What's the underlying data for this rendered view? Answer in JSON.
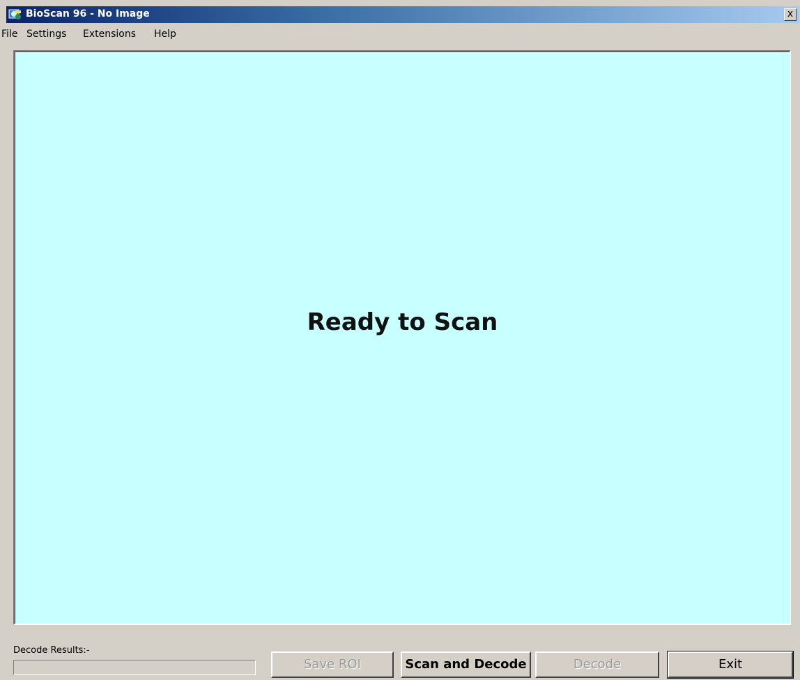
{
  "window": {
    "title": "BioScan 96 - No Image",
    "close_label": "x"
  },
  "menu": {
    "items": [
      "File",
      "Settings",
      "Extensions",
      "Help"
    ]
  },
  "display": {
    "background": "#c8ffff",
    "message": "Ready to Scan"
  },
  "footer": {
    "decode_label": "Decode Results:-",
    "decode_value": "",
    "buttons": {
      "save_roi": "Save ROI",
      "scan_and_decode": "Scan and Decode",
      "decode": "Decode",
      "exit": "Exit"
    }
  },
  "icons": {
    "app": "bioscan-app-icon",
    "close": "close-icon"
  }
}
